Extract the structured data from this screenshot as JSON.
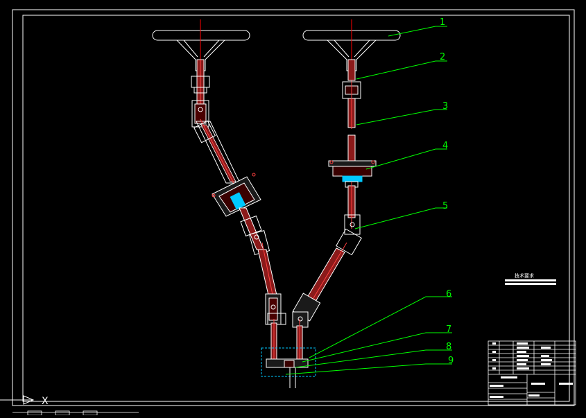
{
  "drawing": {
    "callouts": [
      "1",
      "2",
      "3",
      "4",
      "5",
      "6",
      "7",
      "8",
      "9"
    ],
    "tech_requirements_label": "技术要求",
    "axis_label": "X"
  },
  "colors": {
    "background": "#000000",
    "frame": "#ffffff",
    "callout": "#00ff00",
    "centerline": "#ff0000",
    "shaft_body": "#8b1a1a",
    "highlight": "#00c8ff"
  }
}
